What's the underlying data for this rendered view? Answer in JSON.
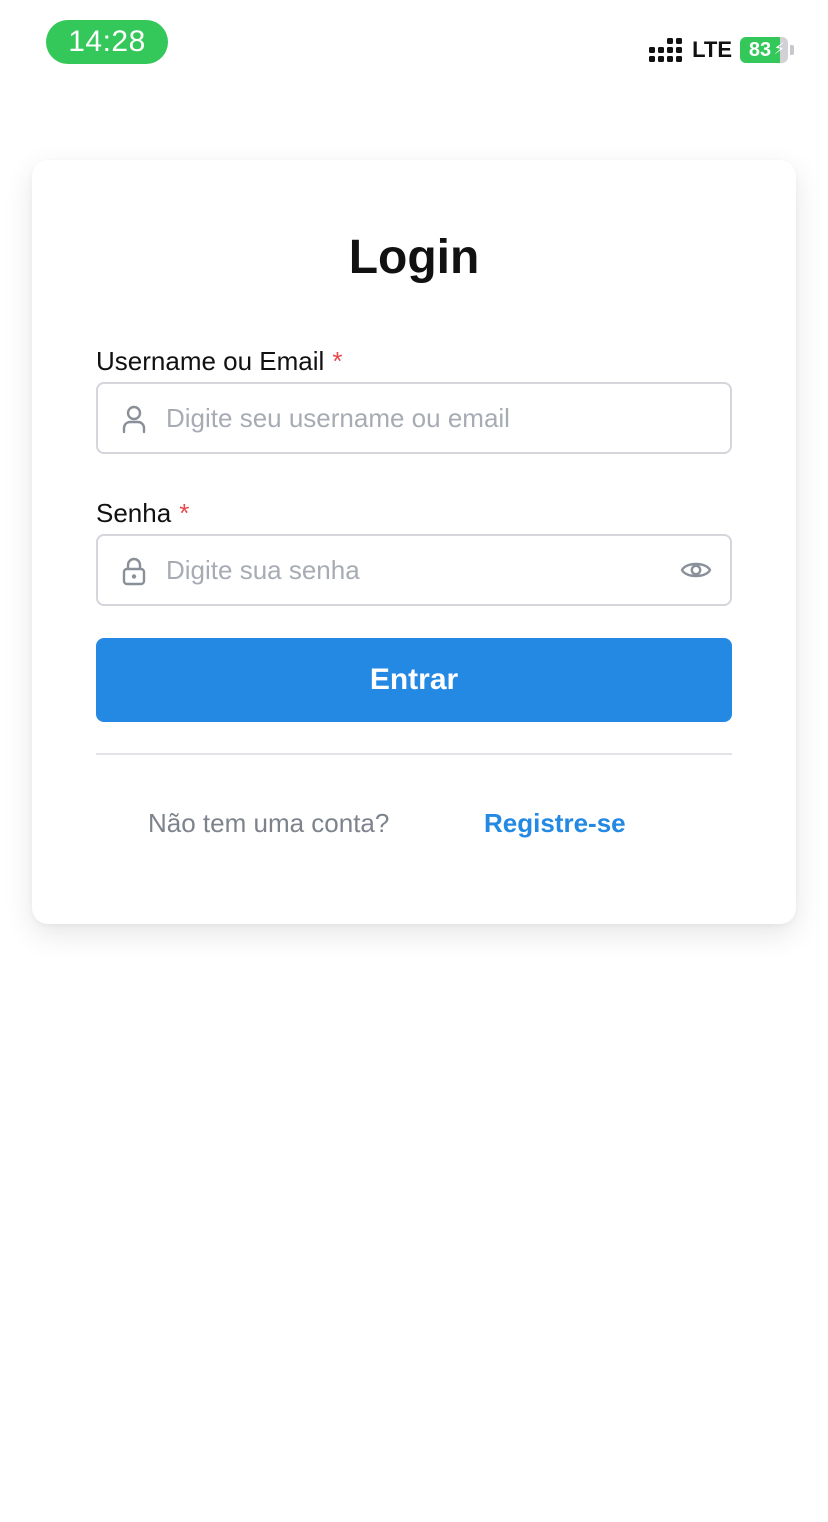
{
  "status_bar": {
    "time": "14:28",
    "network": "LTE",
    "battery_level": "83",
    "battery_percent": 83,
    "battery_charging": true,
    "accent_color": "#34c759"
  },
  "login": {
    "title": "Login",
    "username": {
      "label": "Username ou Email",
      "required_mark": "*",
      "placeholder": "Digite seu username ou email",
      "value": "",
      "icon": "user-icon"
    },
    "password": {
      "label": "Senha",
      "required_mark": "*",
      "placeholder": "Digite sua senha",
      "value": "",
      "icon": "lock-icon",
      "toggle_icon": "eye-icon"
    },
    "submit_label": "Entrar",
    "footer": {
      "prompt": "Não tem uma conta?",
      "register_link": "Registre-se"
    }
  },
  "colors": {
    "primary": "#2389e3",
    "required": "#e5484d",
    "muted_text": "#7d838c",
    "placeholder": "#a7acb4",
    "border": "#d4d6db"
  }
}
